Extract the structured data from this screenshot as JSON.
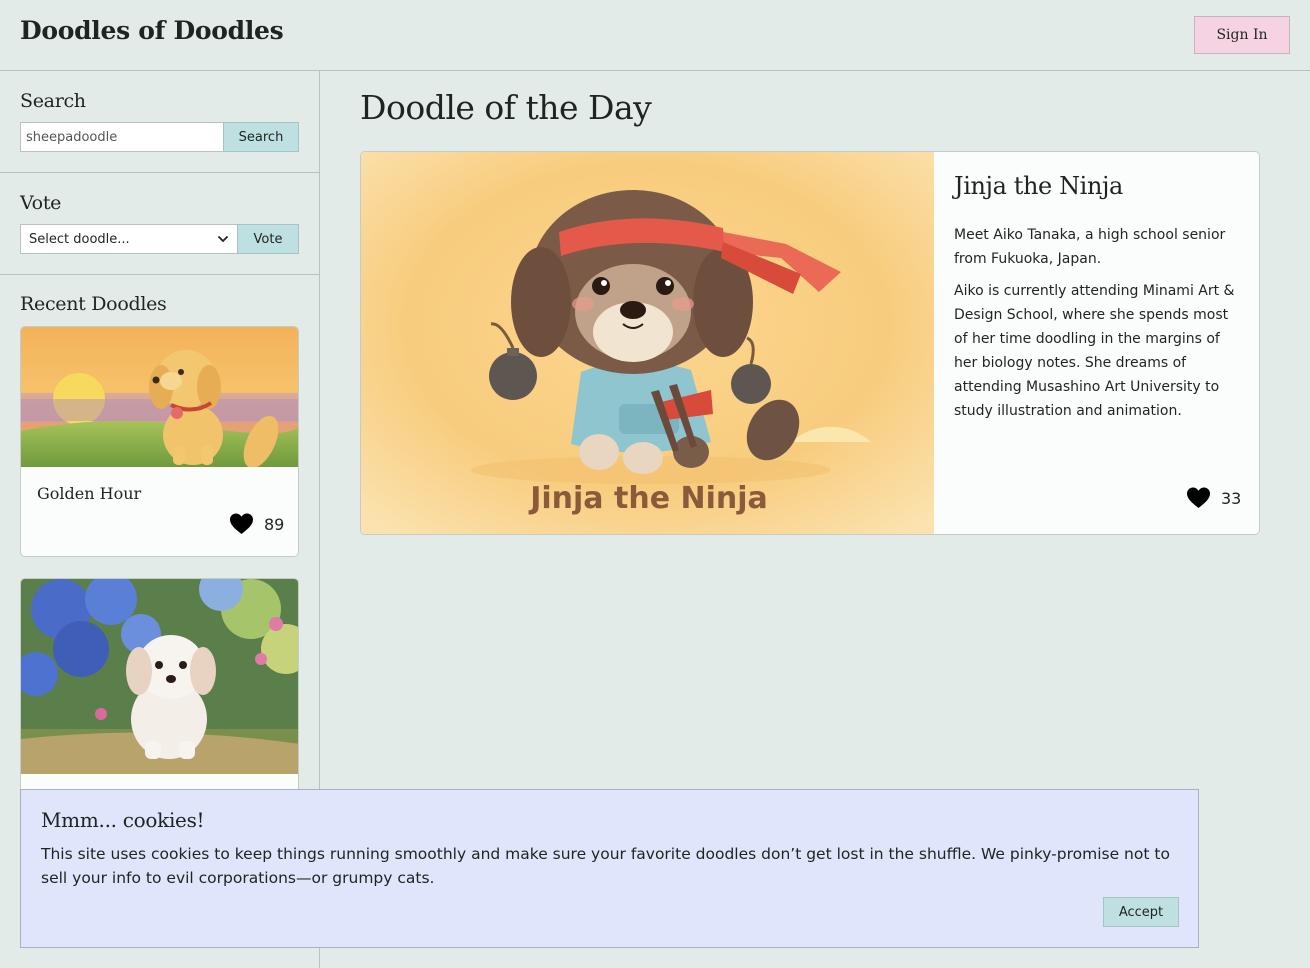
{
  "header": {
    "site_title": "Doodles of Doodles",
    "signin_label": "Sign In"
  },
  "sidebar": {
    "search": {
      "heading": "Search",
      "value": "sheepadoodle",
      "button_label": "Search"
    },
    "vote": {
      "heading": "Vote",
      "select_value": "Select doodle...",
      "button_label": "Vote"
    },
    "recent": {
      "heading": "Recent Doodles",
      "cards": [
        {
          "title": "Golden Hour",
          "likes": "89",
          "image": "golden-puppy-sunset"
        },
        {
          "title": "",
          "likes": "",
          "image": "white-puppy-garden"
        }
      ]
    }
  },
  "main": {
    "heading": "Doodle of the Day",
    "feature": {
      "title": "Jinja the Ninja",
      "image_caption": "Jinja the Ninja",
      "paragraphs": [
        "Meet Aiko Tanaka, a high school senior from Fukuoka, Japan.",
        "Aiko is currently attending Minami Art & Design School, where she spends most of her time doodling in the margins of her biology notes. She dreams of attending Musashino Art University to study illustration and animation."
      ],
      "likes": "33"
    }
  },
  "cookie_banner": {
    "title": "Mmm... cookies!",
    "text": "This site uses cookies to keep things running smoothly and make sure your favorite doodles don’t get lost in the shuffle. We pinky-promise not to sell your info to evil corporations—or grumpy cats.",
    "accept_label": "Accept"
  },
  "icons": {
    "heart": "heart-icon",
    "select_chevron": "chevron-down-icon"
  },
  "colors": {
    "background": "#e3ebe8",
    "signin_bg": "#f6d3e2",
    "teal_button": "#bfe0e1",
    "cookie_bg": "#dfe6fb"
  }
}
